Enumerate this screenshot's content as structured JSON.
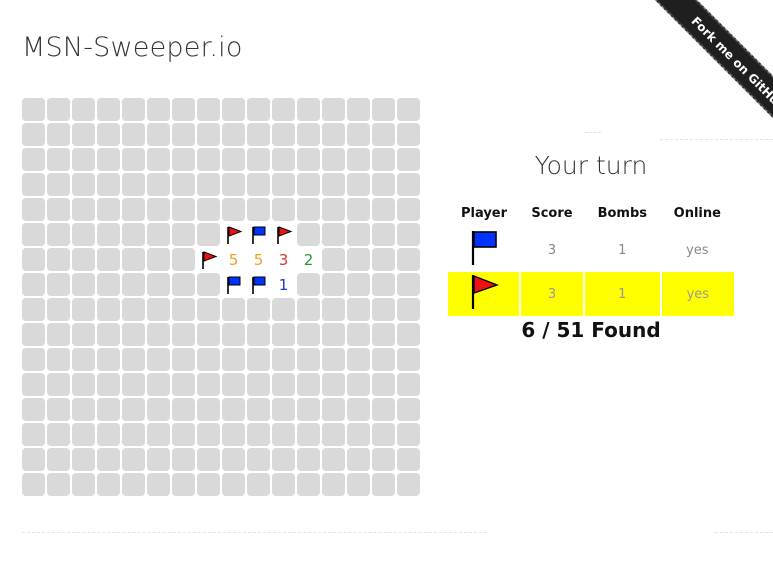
{
  "app": {
    "title": "MSN-Sweeper.io"
  },
  "ribbon": {
    "label": "Fork me on GitHub"
  },
  "status": {
    "turn_text": "Your turn",
    "found_text": "6 / 51 Found"
  },
  "colors": {
    "player_blue": "#0033ff",
    "player_red": "#ee1111",
    "active_row": "#ffff00",
    "cell_closed": "#d9d9d9",
    "number_colors": {
      "1": "#2233cc",
      "2": "#229933",
      "3": "#dd3333",
      "5": "#f0a020"
    }
  },
  "players_table": {
    "headers": [
      "Player",
      "Score",
      "Bombs",
      "Online"
    ],
    "rows": [
      {
        "flag": "blue-flag-icon",
        "score": "3",
        "bombs": "1",
        "online": "yes",
        "active": false
      },
      {
        "flag": "red-flag-icon",
        "score": "3",
        "bombs": "1",
        "online": "yes",
        "active": true
      }
    ]
  },
  "board": {
    "cols": 16,
    "rows": 16,
    "revealed": [
      {
        "row": 5,
        "col": 8,
        "type": "flag",
        "color": "red"
      },
      {
        "row": 5,
        "col": 9,
        "type": "flag",
        "color": "blue"
      },
      {
        "row": 5,
        "col": 10,
        "type": "flag",
        "color": "red"
      },
      {
        "row": 6,
        "col": 7,
        "type": "flag",
        "color": "red"
      },
      {
        "row": 6,
        "col": 8,
        "type": "number",
        "value": "5"
      },
      {
        "row": 6,
        "col": 9,
        "type": "number",
        "value": "5"
      },
      {
        "row": 6,
        "col": 10,
        "type": "number",
        "value": "3"
      },
      {
        "row": 6,
        "col": 11,
        "type": "number",
        "value": "2"
      },
      {
        "row": 7,
        "col": 8,
        "type": "flag",
        "color": "blue"
      },
      {
        "row": 7,
        "col": 9,
        "type": "flag",
        "color": "blue"
      },
      {
        "row": 7,
        "col": 10,
        "type": "number",
        "value": "1"
      }
    ]
  }
}
